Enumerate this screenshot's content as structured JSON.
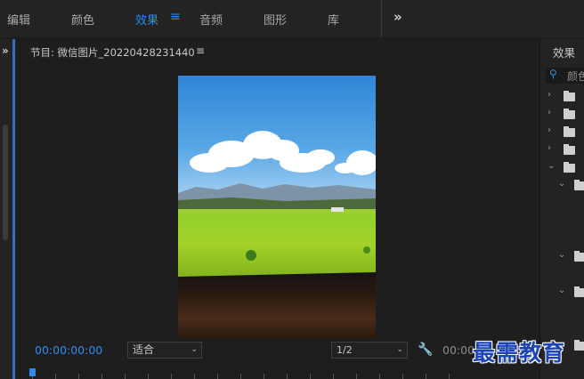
{
  "workspace": {
    "tabs": [
      {
        "label": "编辑",
        "active": false
      },
      {
        "label": "颜色",
        "active": false
      },
      {
        "label": "效果",
        "active": true
      },
      {
        "label": "音频",
        "active": false
      },
      {
        "label": "图形",
        "active": false
      },
      {
        "label": "库",
        "active": false
      }
    ],
    "active_color": "#2d8ceb"
  },
  "program_monitor": {
    "title": "节目: 微信图片_20220428231440",
    "timecode": "00:00:00:00",
    "fit_value": "适合",
    "resolution_value": "1/2",
    "duration_timecode": "00:00"
  },
  "effects_panel": {
    "title": "效果",
    "search_value": "颜色"
  },
  "watermark": "最需教育"
}
